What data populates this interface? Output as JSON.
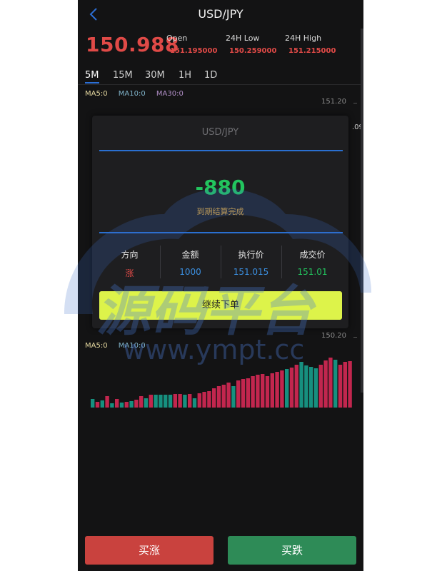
{
  "header": {
    "title": "USD/JPY"
  },
  "price": {
    "current": "150.988"
  },
  "stats": [
    {
      "label": "Open",
      "value": "151.195000"
    },
    {
      "label": "24H Low",
      "value": "150.259000"
    },
    {
      "label": "24H High",
      "value": "151.215000"
    }
  ],
  "tabs": [
    "5M",
    "15M",
    "30M",
    "1H",
    "1D"
  ],
  "ma_main": {
    "ma5": "MA5:0",
    "ma10": "MA10:0",
    "ma30": "MA30:0"
  },
  "ma_volume": {
    "ma5": "MA5:0",
    "ma10": "MA10:0"
  },
  "axis": {
    "top": "151.20",
    "top_partial": ".09",
    "bottom": "150.20"
  },
  "modal": {
    "title": "USD/JPY",
    "result": "-880",
    "result_sub": "到期结算完成",
    "columns": [
      {
        "header": "方向",
        "value": "涨"
      },
      {
        "header": "金额",
        "value": "1000"
      },
      {
        "header": "执行价",
        "value": "151.015"
      },
      {
        "header": "成交价",
        "value": "151.01"
      }
    ],
    "continue_label": "继续下单"
  },
  "watermark": {
    "line1": "源码平台",
    "line2": "www.ympt.cc"
  },
  "actions": {
    "buy_up": "买涨",
    "buy_down": "买跌"
  },
  "colors": {
    "up": "#e04a47",
    "down": "#22c55e",
    "accent_blue": "#2c6fd6",
    "continue_btn": "#ddf34a",
    "buy_up_btn": "#c9423e",
    "buy_down_btn": "#2e8b57",
    "volume_red": "#c2264e",
    "volume_green": "#16907f"
  },
  "volume_bars": [
    {
      "v": 12,
      "c": "green"
    },
    {
      "v": 8,
      "c": "red"
    },
    {
      "v": 10,
      "c": "green"
    },
    {
      "v": 16,
      "c": "red"
    },
    {
      "v": 6,
      "c": "green"
    },
    {
      "v": 12,
      "c": "red"
    },
    {
      "v": 7,
      "c": "green"
    },
    {
      "v": 8,
      "c": "red"
    },
    {
      "v": 9,
      "c": "green"
    },
    {
      "v": 11,
      "c": "red"
    },
    {
      "v": 16,
      "c": "red"
    },
    {
      "v": 13,
      "c": "green"
    },
    {
      "v": 18,
      "c": "red"
    },
    {
      "v": 18,
      "c": "green"
    },
    {
      "v": 18,
      "c": "green"
    },
    {
      "v": 18,
      "c": "green"
    },
    {
      "v": 18,
      "c": "green"
    },
    {
      "v": 19,
      "c": "red"
    },
    {
      "v": 19,
      "c": "red"
    },
    {
      "v": 18,
      "c": "green"
    },
    {
      "v": 19,
      "c": "red"
    },
    {
      "v": 13,
      "c": "green"
    },
    {
      "v": 20,
      "c": "red"
    },
    {
      "v": 22,
      "c": "red"
    },
    {
      "v": 23,
      "c": "red"
    },
    {
      "v": 27,
      "c": "red"
    },
    {
      "v": 30,
      "c": "red"
    },
    {
      "v": 32,
      "c": "red"
    },
    {
      "v": 35,
      "c": "red"
    },
    {
      "v": 30,
      "c": "green"
    },
    {
      "v": 38,
      "c": "red"
    },
    {
      "v": 40,
      "c": "red"
    },
    {
      "v": 41,
      "c": "red"
    },
    {
      "v": 44,
      "c": "red"
    },
    {
      "v": 46,
      "c": "red"
    },
    {
      "v": 47,
      "c": "red"
    },
    {
      "v": 44,
      "c": "red"
    },
    {
      "v": 48,
      "c": "red"
    },
    {
      "v": 50,
      "c": "red"
    },
    {
      "v": 52,
      "c": "red"
    },
    {
      "v": 54,
      "c": "green"
    },
    {
      "v": 56,
      "c": "red"
    },
    {
      "v": 60,
      "c": "red"
    },
    {
      "v": 64,
      "c": "green"
    },
    {
      "v": 59,
      "c": "green"
    },
    {
      "v": 57,
      "c": "green"
    },
    {
      "v": 55,
      "c": "green"
    },
    {
      "v": 60,
      "c": "red"
    },
    {
      "v": 66,
      "c": "red"
    },
    {
      "v": 70,
      "c": "red"
    },
    {
      "v": 67,
      "c": "green"
    },
    {
      "v": 60,
      "c": "red"
    },
    {
      "v": 64,
      "c": "red"
    },
    {
      "v": 65,
      "c": "red"
    }
  ]
}
